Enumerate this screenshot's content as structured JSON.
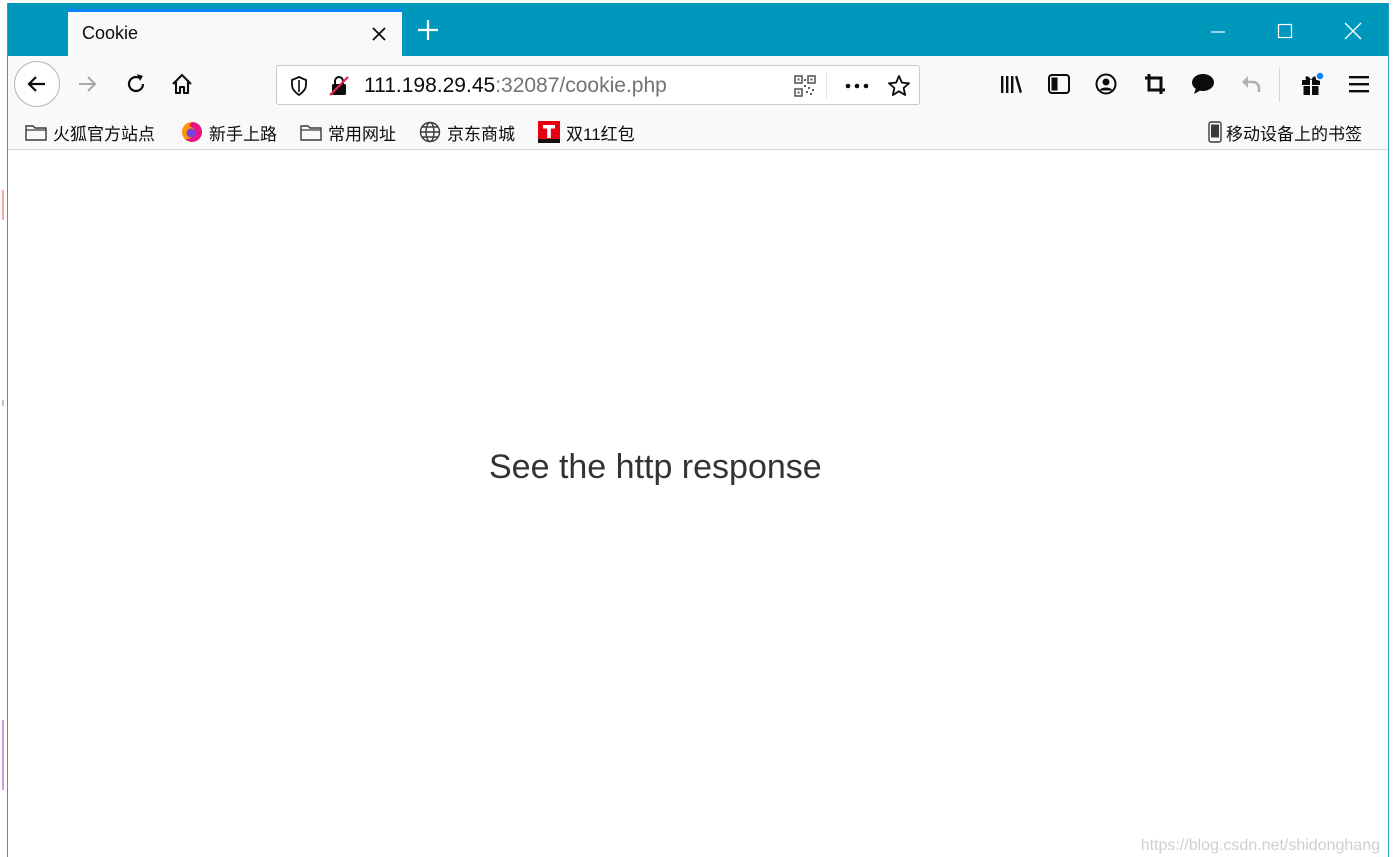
{
  "tab": {
    "title": "Cookie"
  },
  "url": {
    "host": "111.198.29.45",
    "rest": ":32087/cookie.php"
  },
  "bookmarks": {
    "items": [
      {
        "label": "火狐官方站点",
        "icon": "folder-icon"
      },
      {
        "label": "新手上路",
        "icon": "firefox-icon"
      },
      {
        "label": "常用网址",
        "icon": "folder-icon"
      },
      {
        "label": "京东商城",
        "icon": "globe-icon"
      },
      {
        "label": "双11红包",
        "icon": "t-red-icon"
      }
    ],
    "mobile": {
      "label": "移动设备上的书签",
      "icon": "mobile-icon"
    }
  },
  "content": {
    "message": "See the http response"
  },
  "watermark": "https://blog.csdn.net/shidonghang",
  "colors": {
    "tabbar": "#0097bd",
    "tab_accent": "#0a84ff",
    "toolbar": "#f9f9fa",
    "text": "#333333"
  }
}
